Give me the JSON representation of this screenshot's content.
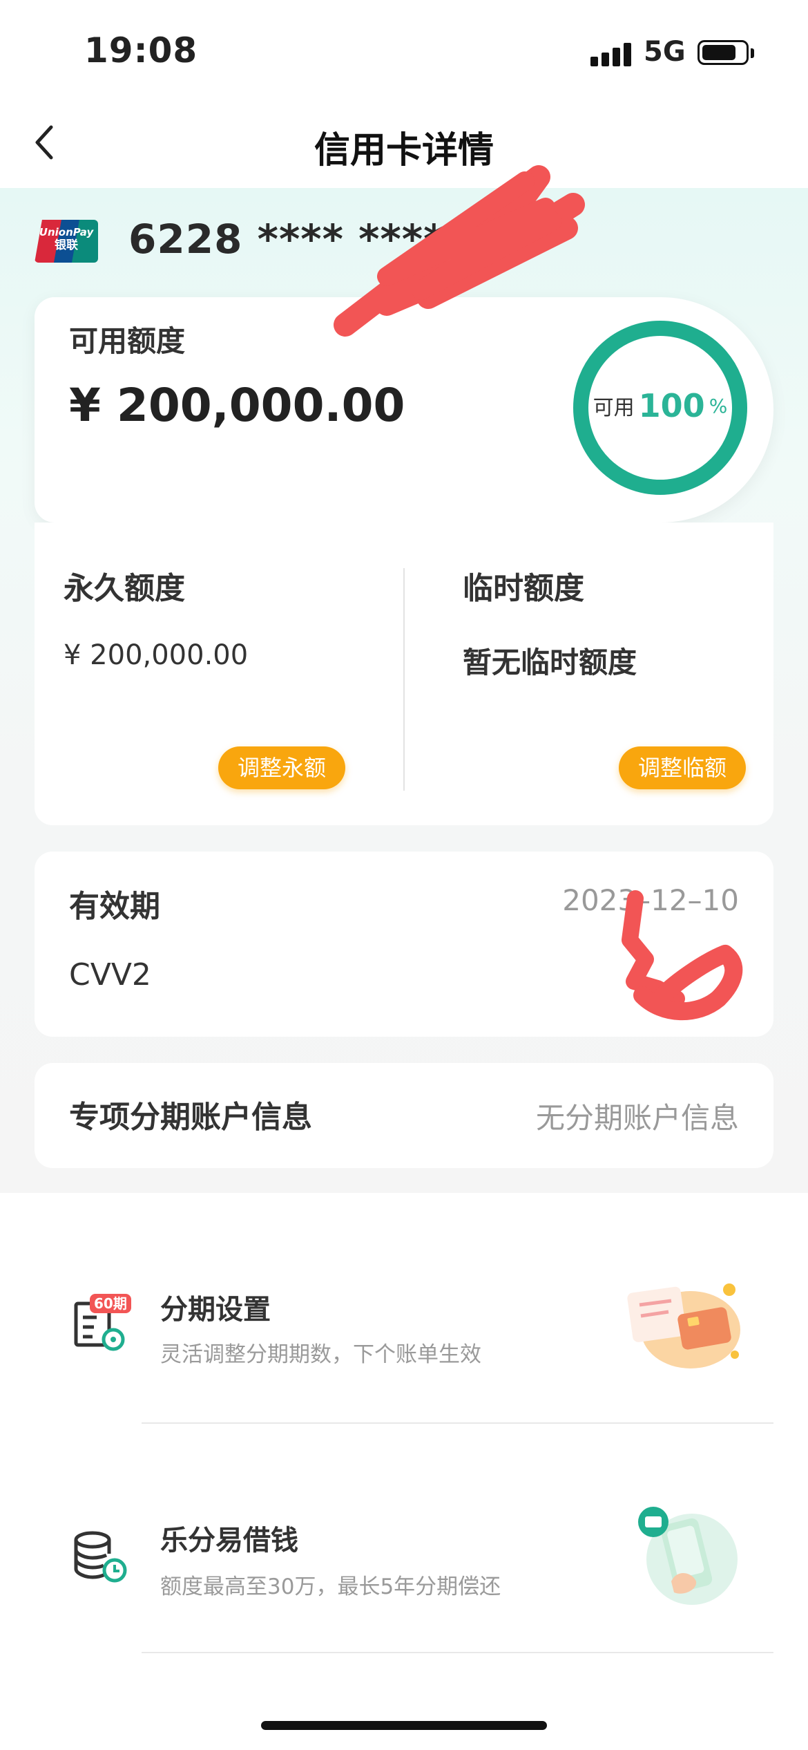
{
  "status_bar": {
    "time": "19:08",
    "network": "5G"
  },
  "nav": {
    "title": "信用卡详情"
  },
  "card": {
    "number_masked": "6228 **** **** "
  },
  "available": {
    "label": "可用额度",
    "amount": "¥ 200,000.00",
    "ring_prefix": "可用",
    "ring_percent": "100",
    "ring_unit": "%",
    "percent_value": 100
  },
  "limits": {
    "permanent_label": "永久额度",
    "permanent_value": "¥ 200,000.00",
    "permanent_button": "调整永额",
    "temporary_label": "临时额度",
    "temporary_value": "暂无临时额度",
    "temporary_button": "调整临额"
  },
  "validity": {
    "label": "有效期",
    "value": "2023–12–10",
    "cvv_label": "CVV2"
  },
  "installment_account": {
    "label": "专项分期账户信息",
    "value": "无分期账户信息"
  },
  "services": [
    {
      "title": "分期设置",
      "subtitle": "灵活调整分期期数，下个账单生效",
      "badge": "60期"
    },
    {
      "title": "乐分易借钱",
      "subtitle": "额度最高至30万，最长5年分期偿还"
    }
  ],
  "colors": {
    "accent": "#2bb497",
    "button": "#f9a60e",
    "redaction": "#f25555"
  }
}
